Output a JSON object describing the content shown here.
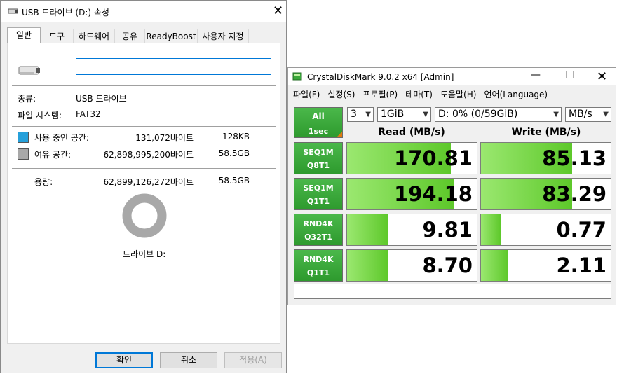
{
  "properties": {
    "title": "USB 드라이브 (D:) 속성",
    "tabs": [
      "일반",
      "도구",
      "하드웨어",
      "공유",
      "ReadyBoost",
      "사용자 지정"
    ],
    "name_value": "",
    "type_label": "종류:",
    "type_value": "USB 드라이브",
    "fs_label": "파일 시스템:",
    "fs_value": "FAT32",
    "used_label": "사용 중인 공간:",
    "used_bytes": "131,072바이트",
    "used_size": "128KB",
    "free_label": "여유 공간:",
    "free_bytes": "62,898,995,200바이트",
    "free_size": "58.5GB",
    "capacity_label": "용량:",
    "capacity_bytes": "62,899,126,272바이트",
    "capacity_size": "58.5GB",
    "drive_label": "드라이브 D:",
    "used_fraction": 2e-06,
    "used_color": "#26a0da",
    "free_color": "#a8a8a8",
    "buttons": {
      "ok": "확인",
      "cancel": "취소",
      "apply": "적용(A)"
    }
  },
  "cdm": {
    "title": "CrystalDiskMark 9.0.2 x64 [Admin]",
    "menu": [
      "파일(F)",
      "설정(S)",
      "프로필(P)",
      "테마(T)",
      "도움말(H)",
      "언어(Language)"
    ],
    "all_label": "All",
    "all_sub": "1sec",
    "count": "3",
    "size": "1GiB",
    "drive": "D: 0% (0/59GiB)",
    "unit": "MB/s",
    "read_header": "Read (MB/s)",
    "write_header": "Write (MB/s)",
    "accent_color": "#3aa83a",
    "rows": [
      {
        "l1": "SEQ1M",
        "l2": "Q8T1",
        "read": "170.81",
        "write": "85.13",
        "read_fill": 0.8,
        "write_fill": 0.7
      },
      {
        "l1": "SEQ1M",
        "l2": "Q1T1",
        "read": "194.18",
        "write": "83.29",
        "read_fill": 0.82,
        "write_fill": 0.7
      },
      {
        "l1": "RND4K",
        "l2": "Q32T1",
        "read": "9.81",
        "write": "0.77",
        "read_fill": 0.32,
        "write_fill": 0.15
      },
      {
        "l1": "RND4K",
        "l2": "Q1T1",
        "read": "8.70",
        "write": "2.11",
        "read_fill": 0.32,
        "write_fill": 0.21
      }
    ],
    "comment": ""
  }
}
